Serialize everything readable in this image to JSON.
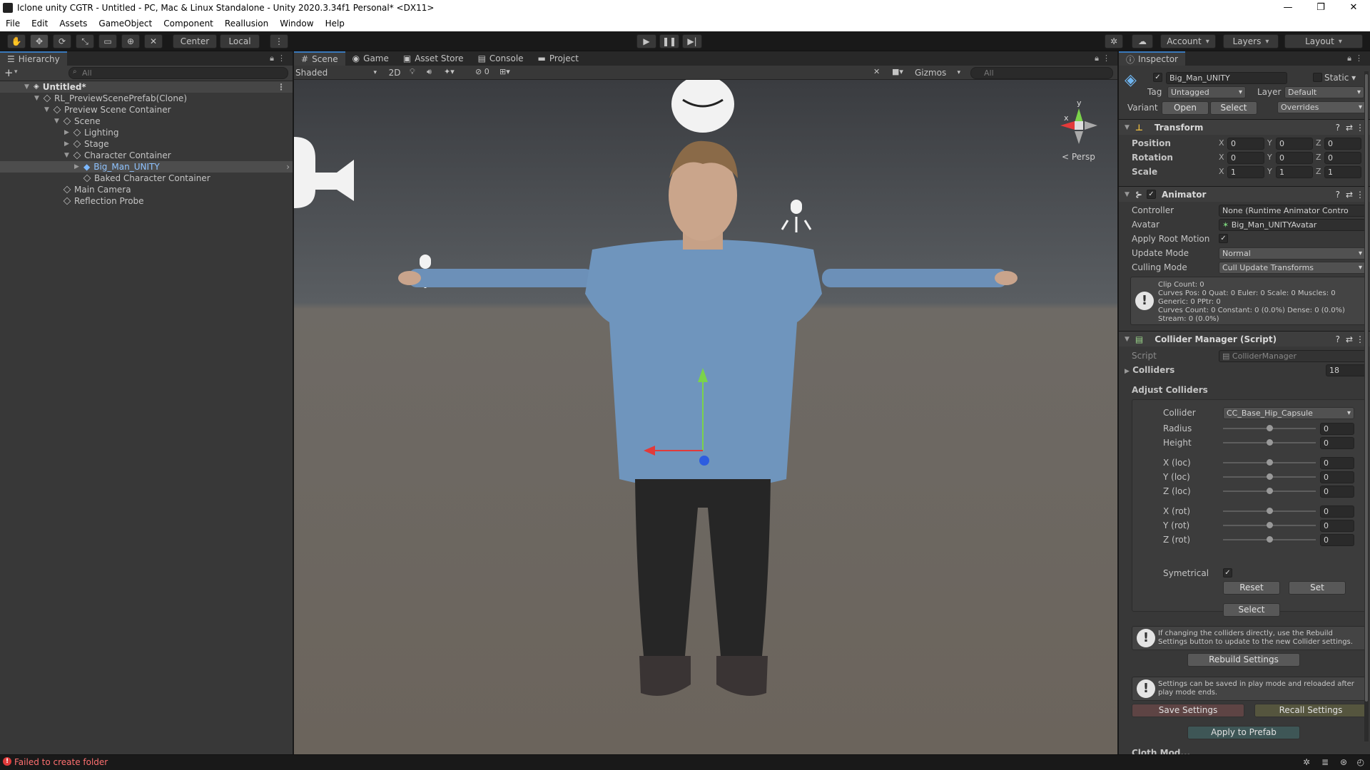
{
  "window": {
    "title": "Iclone unity CGTR - Untitled - PC, Mac & Linux Standalone - Unity 2020.3.34f1 Personal* <DX11>",
    "minimize": "—",
    "maximize": "❐",
    "close": "✕"
  },
  "menu": [
    "File",
    "Edit",
    "Assets",
    "GameObject",
    "Component",
    "Reallusion",
    "Window",
    "Help"
  ],
  "toolbar": {
    "pivot": "Center",
    "space": "Local",
    "account": "Account",
    "layers": "Layers",
    "layout": "Layout"
  },
  "hierarchy": {
    "tab": "Hierarchy",
    "search_placeholder": "All",
    "add": "+",
    "rows": [
      "Untitled*",
      "RL_PreviewScenePrefab(Clone)",
      "Preview Scene Container",
      "Scene",
      "Lighting",
      "Stage",
      "Character Container",
      "Big_Man_UNITY",
      "Baked Character Container",
      "Main Camera",
      "Reflection Probe"
    ]
  },
  "scene": {
    "tabs": [
      "Scene",
      "Game",
      "Asset Store",
      "Console",
      "Project"
    ],
    "shading": "Shaded",
    "mode2d": "2D",
    "hidden_count": "0",
    "gizmos": "Gizmos",
    "search_placeholder": "All",
    "persp": "< Persp",
    "axis_x": "x",
    "axis_y": "y"
  },
  "inspector": {
    "tab": "Inspector",
    "object_name": "Big_Man_UNITY",
    "static_label": "Static",
    "tag_label": "Tag",
    "tag_value": "Untagged",
    "layer_label": "Layer",
    "layer_value": "Default",
    "variant_label": "Variant",
    "open": "Open",
    "select": "Select",
    "overrides": "Overrides",
    "transform": {
      "title": "Transform",
      "rows": [
        {
          "label": "Position",
          "x": "0",
          "y": "0",
          "z": "0"
        },
        {
          "label": "Rotation",
          "x": "0",
          "y": "0",
          "z": "0"
        },
        {
          "label": "Scale",
          "x": "1",
          "y": "1",
          "z": "1"
        }
      ],
      "ax": "X",
      "ay": "Y",
      "az": "Z"
    },
    "animator": {
      "title": "Animator",
      "controller_label": "Controller",
      "controller_value": "None (Runtime Animator Contro",
      "avatar_label": "Avatar",
      "avatar_value": "Big_Man_UNITYAvatar",
      "root_motion_label": "Apply Root Motion",
      "update_mode_label": "Update Mode",
      "update_mode_value": "Normal",
      "culling_label": "Culling Mode",
      "culling_value": "Cull Update Transforms",
      "info": [
        "Clip Count: 0",
        "Curves Pos: 0 Quat: 0 Euler: 0 Scale: 0 Muscles: 0",
        "Generic: 0 PPtr: 0",
        "Curves Count: 0 Constant: 0 (0.0%) Dense: 0 (0.0%)",
        "Stream: 0 (0.0%)"
      ]
    },
    "collider_manager": {
      "title": "Collider Manager (Script)",
      "script_label": "Script",
      "script_value": "ColliderManager",
      "colliders_label": "Colliders",
      "colliders_count": "18",
      "adjust_label": "Adjust Colliders",
      "collider_label": "Collider",
      "collider_value": "CC_Base_Hip_Capsule",
      "params": [
        {
          "label": "Radius",
          "value": "0",
          "level": 0.5
        },
        {
          "label": "Height",
          "value": "0",
          "level": 0.5
        },
        {
          "label": "X (loc)",
          "value": "0",
          "level": 0.5
        },
        {
          "label": "Y (loc)",
          "value": "0",
          "level": 0.5
        },
        {
          "label": "Z (loc)",
          "value": "0",
          "level": 0.5
        },
        {
          "label": "X (rot)",
          "value": "0",
          "level": 0.5
        },
        {
          "label": "Y (rot)",
          "value": "0",
          "level": 0.5
        },
        {
          "label": "Z (rot)",
          "value": "0",
          "level": 0.5
        }
      ],
      "symetrical_label": "Symetrical",
      "reset": "Reset",
      "set": "Set",
      "select": "Select",
      "rebuild_help": "If changing the colliders directly, use the Rebuild Settings button to update to the new Collider settings.",
      "rebuild": "Rebuild Settings",
      "save_help": "Settings can be saved in play mode and reloaded after play mode ends.",
      "save": "Save Settings",
      "recall": "Recall Settings",
      "apply_prefab": "Apply to Prefab",
      "cut_label": "Cloth Mod..."
    }
  },
  "status": {
    "message": "Failed to create folder"
  }
}
